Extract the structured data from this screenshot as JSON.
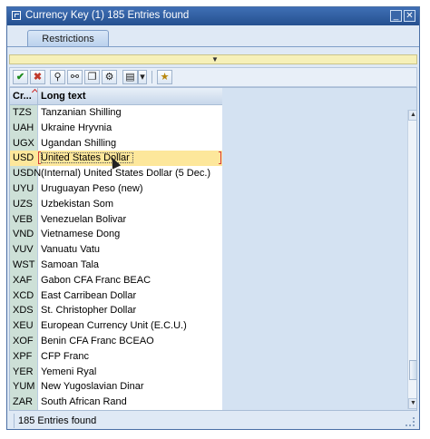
{
  "window": {
    "title": "Currency Key (1)  185 Entries found",
    "minimize_glyph": "_",
    "close_glyph": "✕"
  },
  "tabs": [
    {
      "label": "Restrictions"
    }
  ],
  "toolbar": {
    "icons": [
      "check-icon",
      "close-icon",
      "find-icon",
      "find-next-icon",
      "copy-icon",
      "settings-icon",
      "print-icon",
      "dropdown-icon",
      "favorite-icon"
    ]
  },
  "grid": {
    "headers": {
      "code": "Cr...",
      "text": "Long text"
    },
    "rows": [
      {
        "code": "TZS",
        "text": "Tanzanian Shilling"
      },
      {
        "code": "UAH",
        "text": "Ukraine Hryvnia"
      },
      {
        "code": "UGX",
        "text": "Ugandan Shilling"
      },
      {
        "code": "USD",
        "text": "United States Dollar",
        "selected": true
      },
      {
        "code": "USDN",
        "text": "(Internal) United States Dollar (5 Dec.)"
      },
      {
        "code": "UYU",
        "text": "Uruguayan Peso (new)"
      },
      {
        "code": "UZS",
        "text": "Uzbekistan Som"
      },
      {
        "code": "VEB",
        "text": "Venezuelan Bolivar"
      },
      {
        "code": "VND",
        "text": "Vietnamese Dong"
      },
      {
        "code": "VUV",
        "text": "Vanuatu Vatu"
      },
      {
        "code": "WST",
        "text": "Samoan Tala"
      },
      {
        "code": "XAF",
        "text": "Gabon CFA Franc BEAC"
      },
      {
        "code": "XCD",
        "text": "East Carribean Dollar"
      },
      {
        "code": "XDS",
        "text": "St. Christopher Dollar"
      },
      {
        "code": "XEU",
        "text": "European Currency Unit (E.C.U.)"
      },
      {
        "code": "XOF",
        "text": "Benin CFA Franc BCEAO"
      },
      {
        "code": "XPF",
        "text": "CFP Franc"
      },
      {
        "code": "YER",
        "text": "Yemeni Ryal"
      },
      {
        "code": "YUM",
        "text": "New Yugoslavian Dinar"
      },
      {
        "code": "ZAR",
        "text": "South African Rand"
      }
    ]
  },
  "status": {
    "text": "185 Entries found"
  },
  "colors": {
    "title_bar": "#2f5f9f",
    "selection": "#fde79b",
    "code_column": "#cde0d7"
  }
}
